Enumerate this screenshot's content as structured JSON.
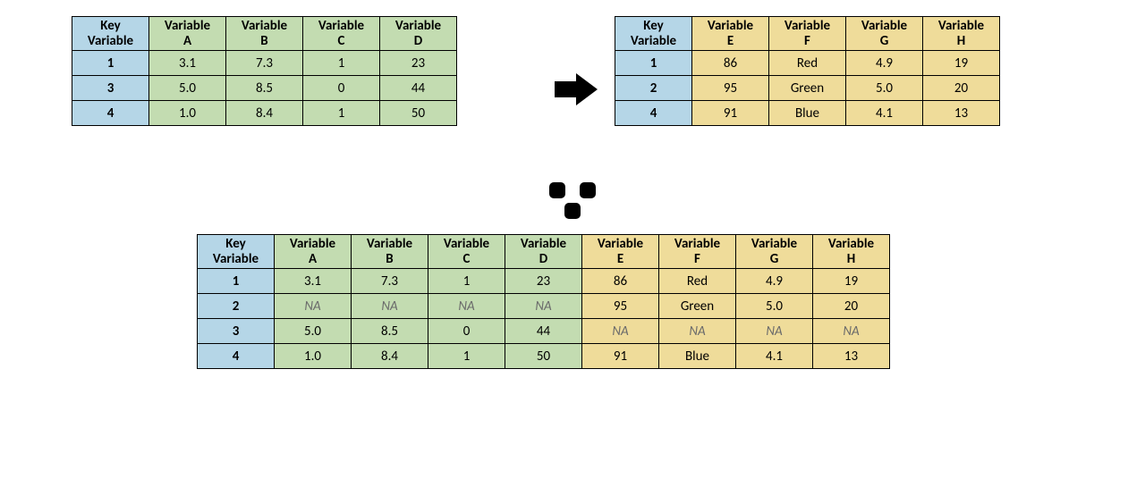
{
  "labels": {
    "key_header_line1": "Key",
    "key_header_line2": "Variable",
    "var_header_line1": "Variable",
    "na": "NA"
  },
  "tableLeft": {
    "vars": [
      "A",
      "B",
      "C",
      "D"
    ],
    "rows": [
      {
        "key": "1",
        "v": [
          "3.1",
          "7.3",
          "1",
          "23"
        ]
      },
      {
        "key": "3",
        "v": [
          "5.0",
          "8.5",
          "0",
          "44"
        ]
      },
      {
        "key": "4",
        "v": [
          "1.0",
          "8.4",
          "1",
          "50"
        ]
      }
    ]
  },
  "tableRight": {
    "vars": [
      "E",
      "F",
      "G",
      "H"
    ],
    "rows": [
      {
        "key": "1",
        "v": [
          "86",
          "Red",
          "4.9",
          "19"
        ]
      },
      {
        "key": "2",
        "v": [
          "95",
          "Green",
          "5.0",
          "20"
        ]
      },
      {
        "key": "4",
        "v": [
          "91",
          "Blue",
          "4.1",
          "13"
        ]
      }
    ]
  },
  "tableMerged": {
    "varsA": [
      "A",
      "B",
      "C",
      "D"
    ],
    "varsB": [
      "E",
      "F",
      "G",
      "H"
    ],
    "rows": [
      {
        "key": "1",
        "a": [
          "3.1",
          "7.3",
          "1",
          "23"
        ],
        "b": [
          "86",
          "Red",
          "4.9",
          "19"
        ]
      },
      {
        "key": "2",
        "a": [
          "NA",
          "NA",
          "NA",
          "NA"
        ],
        "b": [
          "95",
          "Green",
          "5.0",
          "20"
        ]
      },
      {
        "key": "3",
        "a": [
          "5.0",
          "8.5",
          "0",
          "44"
        ],
        "b": [
          "NA",
          "NA",
          "NA",
          "NA"
        ]
      },
      {
        "key": "4",
        "a": [
          "1.0",
          "8.4",
          "1",
          "50"
        ],
        "b": [
          "91",
          "Blue",
          "4.1",
          "13"
        ]
      }
    ]
  }
}
